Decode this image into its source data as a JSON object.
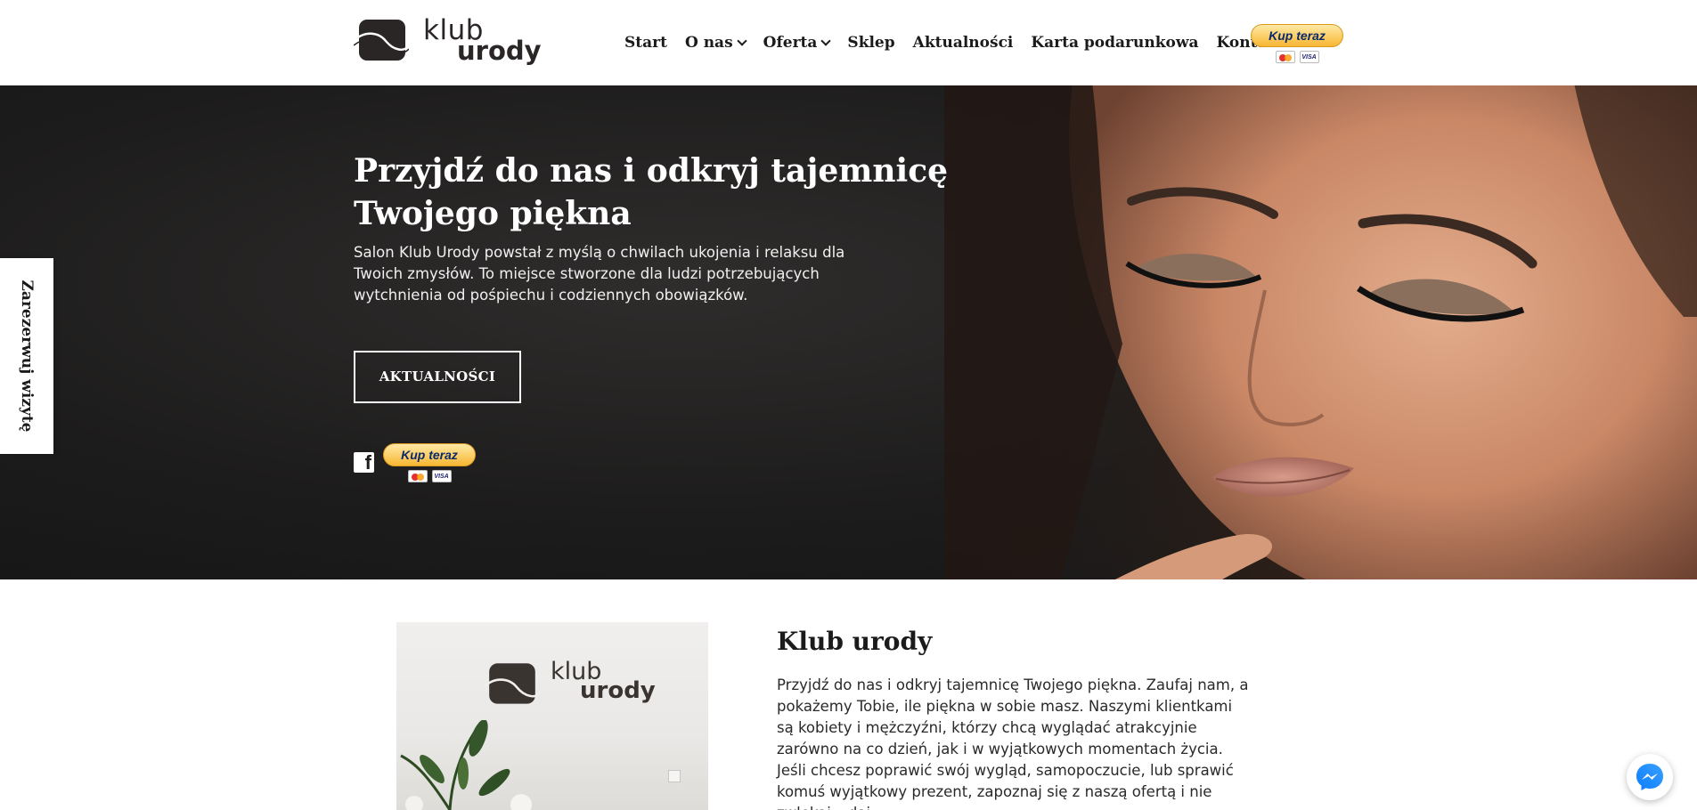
{
  "logo": {
    "line1": "klub",
    "line2": "urody"
  },
  "nav": {
    "items": [
      {
        "label": "Start",
        "dropdown": false
      },
      {
        "label": "O nas",
        "dropdown": true
      },
      {
        "label": "Oferta",
        "dropdown": true
      },
      {
        "label": "Sklep",
        "dropdown": false
      },
      {
        "label": "Aktualności",
        "dropdown": false
      },
      {
        "label": "Karta podarunkowa",
        "dropdown": false
      },
      {
        "label": "Kontakt",
        "dropdown": false
      }
    ],
    "paypal_label": "Kup teraz",
    "card_visa": "VISA"
  },
  "hero": {
    "title": "Przyjdź do nas i odkryj tajemnicę Twojego piękna",
    "text": "Salon Klub Urody powstał z myślą o chwilach ukojenia i relaksu dla Twoich zmysłów. To miejsce stworzone dla ludzi potrzebujących wytchnienia od pośpiechu i codziennych obowiązków.",
    "cta_label": "AKTUALNOŚCI",
    "facebook_glyph": "f",
    "paypal_label": "Kup teraz",
    "card_visa": "VISA"
  },
  "side_tab": {
    "label": "Zarezerwuj wizytę"
  },
  "about": {
    "title": "Klub urody",
    "text": "Przyjdź do nas i odkryj tajemnicę Twojego piękna. Zaufaj nam, a pokażemy Tobie, ile piękna w sobie masz. Naszymi klientkami są kobiety i mężczyźni, którzy chcą wyglądać atrakcyjnie zarówno na co dzień, jak i w wyjątkowych momentach życia. Jeśli chcesz poprawić swój wygląd, samopoczucie, lub sprawić komuś wyjątkowy prezent, zapoznaj się z naszą ofertą i nie zwlekaj, „daj",
    "image_logo": {
      "line1": "klub",
      "line2": "urody"
    }
  },
  "colors": {
    "hero_bg": "#1d1c1c",
    "text_dark": "#1b1b1b",
    "paypal_yellow": "#f7b733",
    "messenger_blue": "#1877f2"
  },
  "icons": [
    "chevron-down-icon",
    "facebook-icon",
    "messenger-icon",
    "mastercard-icon",
    "visa-icon"
  ]
}
